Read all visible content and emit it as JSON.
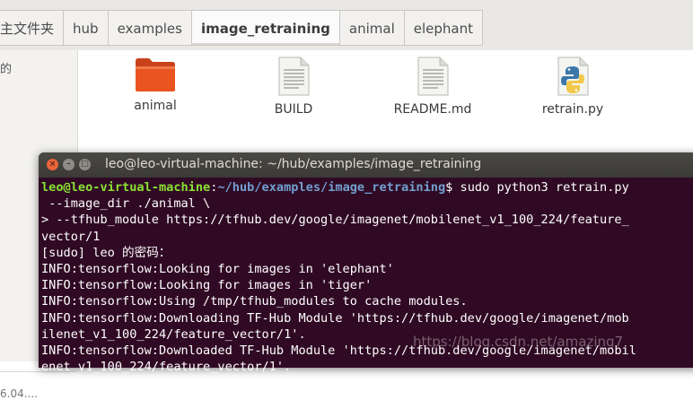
{
  "file_manager": {
    "breadcrumbs": [
      "主文件夹",
      "hub",
      "examples",
      "image_retraining",
      "animal",
      "elephant"
    ],
    "active_crumb": 3,
    "sidebar_text": "的",
    "sidebar_bottom_text": "6.04....",
    "files": [
      {
        "name": "animal",
        "icon": "folder-icon"
      },
      {
        "name": "BUILD",
        "icon": "text-file-icon"
      },
      {
        "name": "README.md",
        "icon": "text-file-icon"
      },
      {
        "name": "retrain.py",
        "icon": "python-file-icon"
      }
    ],
    "colors": {
      "folder": "#e95420",
      "topbar": "#e9e8e5"
    }
  },
  "terminal": {
    "title": "leo@leo-virtual-machine: ~/hub/examples/image_retraining",
    "prompt_user": "leo@leo-virtual-machine",
    "prompt_sep": ":",
    "prompt_path": "~/hub/examples/image_retraining",
    "prompt_end": "$ ",
    "command": "sudo python3 retrain.py",
    "lines": [
      " --image_dir ./animal \\",
      "> --tfhub_module https://tfhub.dev/google/imagenet/mobilenet_v1_100_224/feature_",
      "vector/1",
      "[sudo] leo 的密码：",
      "INFO:tensorflow:Looking for images in 'elephant'",
      "INFO:tensorflow:Looking for images in 'tiger'",
      "INFO:tensorflow:Using /tmp/tfhub_modules to cache modules.",
      "INFO:tensorflow:Downloading TF-Hub Module 'https://tfhub.dev/google/imagenet/mob",
      "ilenet_v1_100_224/feature_vector/1'.",
      "INFO:tensorflow:Downloaded TF-Hub Module 'https://tfhub.dev/google/imagenet/mobil",
      "enet_v1_100_224/feature_vector/1'."
    ],
    "colors": {
      "background": "#300a24",
      "user": "#8ae234",
      "path": "#729fcf"
    }
  },
  "watermark": "https://blog.csdn.net/amazing7"
}
